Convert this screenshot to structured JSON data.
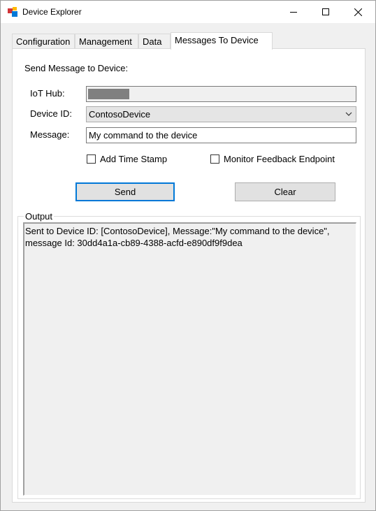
{
  "window": {
    "title": "Device Explorer"
  },
  "tabs": [
    {
      "label": "Configuration"
    },
    {
      "label": "Management"
    },
    {
      "label": "Data"
    },
    {
      "label": "Messages To Device"
    }
  ],
  "form": {
    "heading": "Send Message to Device:",
    "iot_hub_label": "IoT Hub:",
    "iot_hub_value": "",
    "device_id_label": "Device ID:",
    "device_id_value": "ContosoDevice",
    "message_label": "Message:",
    "message_value": "My command to the device",
    "add_timestamp_label": "Add Time Stamp",
    "monitor_feedback_label": "Monitor Feedback Endpoint",
    "send_label": "Send",
    "clear_label": "Clear"
  },
  "output": {
    "label": "Output",
    "text": "Sent to Device ID: [ContosoDevice], Message:\"My command to the device\",\nmessage Id: 30dd4a1a-cb89-4388-acfd-e890df9f9dea"
  },
  "colors": {
    "accent": "#0078d7",
    "window_bg": "#f0f0f0"
  }
}
